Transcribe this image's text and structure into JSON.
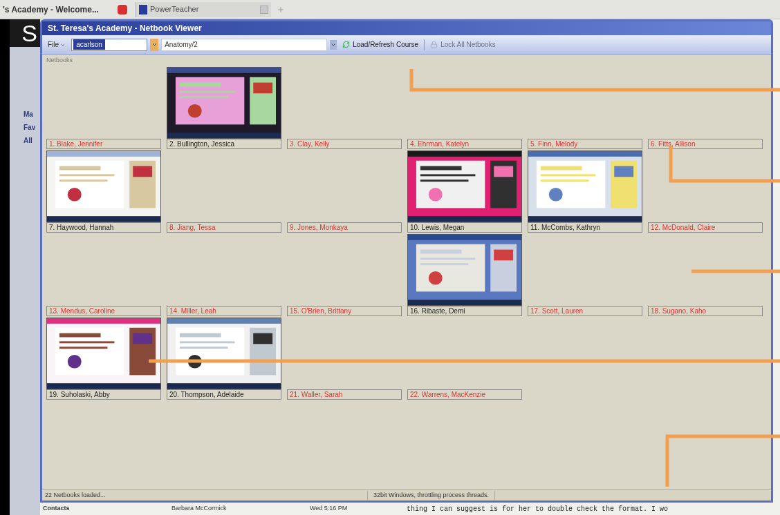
{
  "browser_tabs": [
    {
      "label": "'s Academy - Welcome...",
      "selected": true
    },
    {
      "label": "PowerTeacher",
      "selected": false
    }
  ],
  "background": {
    "banner_letter": "S",
    "sidebar_fragments": [
      "Ma",
      "Fav",
      "All"
    ],
    "contacts": "Contacts",
    "mail_sender": "Barbara McCormick",
    "mail_time": "Wed 5:16 PM",
    "document_line": "thing I can suggest is for her to double check the format.  I wo"
  },
  "window": {
    "title": "St. Teresa's Academy - Netbook Viewer"
  },
  "toolbar": {
    "file_menu": "File",
    "user_field": {
      "value": "acarlson"
    },
    "course_field": {
      "value": "Anatomy/2"
    },
    "load_button": {
      "label": "Load/Refresh Course",
      "disabled": false
    },
    "lock_button": {
      "label": "Lock All Netbooks",
      "disabled": true
    }
  },
  "group_label": "Netbooks",
  "netbooks": [
    {
      "label": "1. Blake, Jennifer",
      "online": false
    },
    {
      "label": "2. Bullington, Jessica",
      "online": true
    },
    {
      "label": "3. Clay, Kelly",
      "online": false
    },
    {
      "label": "4. Ehrman, Katelyn",
      "online": false
    },
    {
      "label": "5. Finn, Melody",
      "online": false
    },
    {
      "label": "6. Fitts, Allison",
      "online": false
    },
    {
      "label": "7. Haywood, Hannah",
      "online": true
    },
    {
      "label": "8. Jiang, Tessa",
      "online": false
    },
    {
      "label": "9. Jones, Monkaya",
      "online": false
    },
    {
      "label": "10. Lewis, Megan",
      "online": true
    },
    {
      "label": "11. McCombs, Kathryn",
      "online": true
    },
    {
      "label": "12. McDonald, Claire",
      "online": false
    },
    {
      "label": "13. Mendus, Caroline",
      "online": false
    },
    {
      "label": "14. Miller, Leah",
      "online": false
    },
    {
      "label": "15. O'Brien, Brittany",
      "online": false
    },
    {
      "label": "16. Ribaste, Demi",
      "online": true
    },
    {
      "label": "17. Scott, Lauren",
      "online": false
    },
    {
      "label": "18. Sugano, Kaho",
      "online": false
    },
    {
      "label": "19. Suholaski, Abby",
      "online": true
    },
    {
      "label": "20. Thompson, Adelaide",
      "online": true
    },
    {
      "label": "21. Waller, Sarah",
      "online": false
    },
    {
      "label": "22. Warrens, MacKenzie",
      "online": false
    }
  ],
  "status_bar": [
    "22 Netbooks loaded...",
    "32bit Windows, throttling process threads."
  ]
}
